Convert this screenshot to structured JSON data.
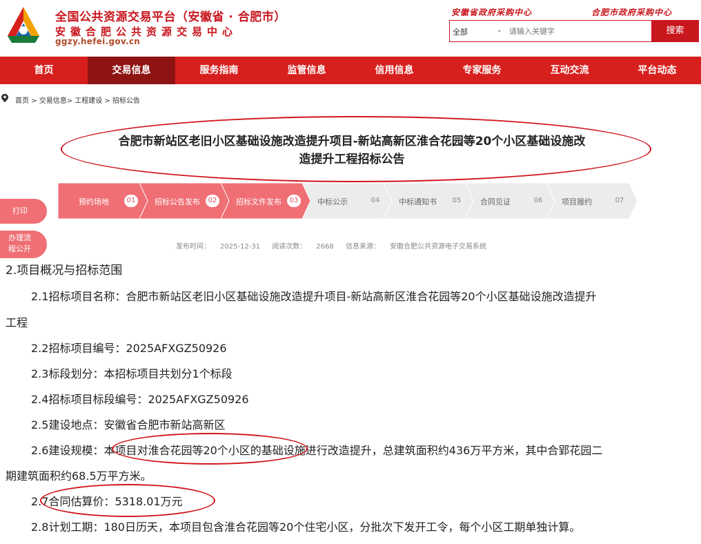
{
  "header": {
    "title": "全国公共资源交易平台（安徽省 · 合肥市）",
    "subtitle": "安徽合肥公共资源交易中心",
    "url": "ggzy.hefei.gov.cn",
    "link_province": "安徽省政府采购中心",
    "link_city": "合肥市政府采购中心",
    "search": {
      "category": "全部",
      "placeholder": "请输入关键字",
      "button": "搜索"
    },
    "colors": {
      "brand_red": "#d7201e",
      "nav_active": "#8e1414"
    }
  },
  "nav": {
    "items": [
      "首页",
      "交易信息",
      "服务指南",
      "监管信息",
      "信用信息",
      "专家服务",
      "互动交流",
      "平台动态"
    ],
    "active": "交易信息"
  },
  "breadcrumb": "首页 > 交易信息> 工程建设 > 招标公告",
  "article": {
    "title_line1": "合肥市新站区老旧小区基础设施改造提升项目-新站高新区淮合花园等20个小区基础设施改",
    "title_line2": "造提升工程招标公告",
    "steps": [
      {
        "label": "预约场地",
        "num": "01",
        "done": true
      },
      {
        "label": "招标公告发布",
        "num": "02",
        "done": true
      },
      {
        "label": "招标文件发布",
        "num": "03",
        "done": true
      },
      {
        "label": "中标公示",
        "num": "04",
        "done": false
      },
      {
        "label": "中标通知书",
        "num": "05",
        "done": false
      },
      {
        "label": "合同见证",
        "num": "06",
        "done": false
      },
      {
        "label": "项目履约",
        "num": "07",
        "done": false
      }
    ],
    "meta": {
      "time_label": "发布时间：",
      "time": "2025-12-31",
      "views_label": "阅读次数：",
      "views": "2668",
      "source_label": "信息来源：",
      "source": "安徽合肥公共资源电子交易系统"
    }
  },
  "side": {
    "print": "打印",
    "flow_line1": "办理流",
    "flow_line2": "程公开"
  },
  "body": {
    "heading": "2.项目概况与招标范围",
    "p21a": "2.1招标项目名称：合肥市新站区老旧小区基础设施改造提升项目-新站高新区淮合花园等20个小区基础设施改造提升",
    "p21b": "工程",
    "p22": "2.2招标项目编号：2025AFXGZ50926",
    "p23": "2.3标段划分：本招标项目共划分1个标段",
    "p24": "2.4招标项目标段编号：2025AFXGZ50926",
    "p25": "2.5建设地点：安徽省合肥市新站高新区",
    "p26a": "2.6建设规模：本项目对淮合花园等20个小区的基础设施进行改造提升，总建筑面积约436万平方米，其中合郢花园二",
    "p26b": "期建筑面积约68.5万平方米。",
    "p27": "2.7合同估算价：5318.01万元",
    "p28": "2.8计划工期：180日历天，本项目包含淮合花园等20个住宅小区，分批次下发开工令，每个小区工期单独计算。"
  }
}
